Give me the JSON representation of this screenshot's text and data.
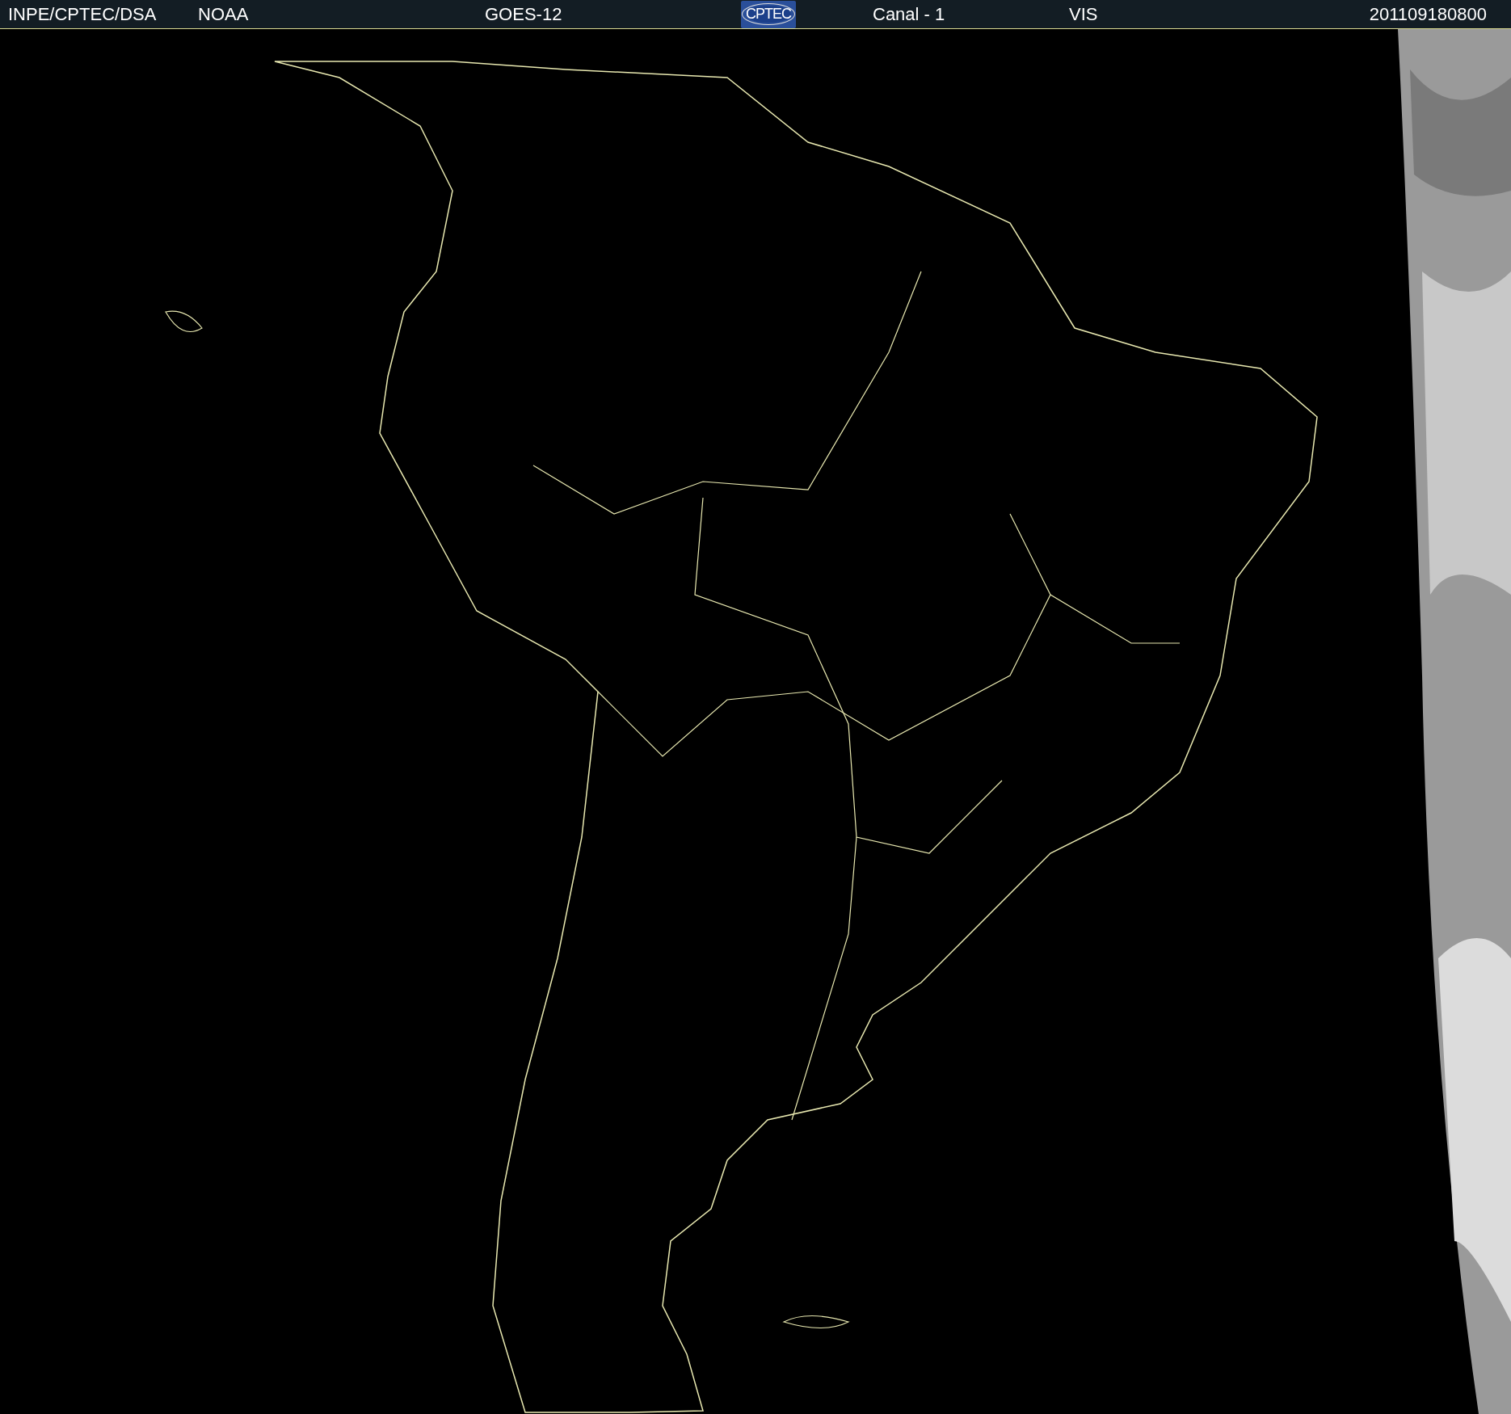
{
  "header": {
    "items": [
      {
        "kind": "text",
        "text": "INPE/CPTEC/DSA"
      },
      {
        "kind": "text",
        "text": "NOAA"
      },
      {
        "kind": "text",
        "text": "GOES-12"
      },
      {
        "kind": "logo",
        "text": "CPTEC"
      },
      {
        "kind": "text",
        "text": "Canal - 1"
      },
      {
        "kind": "text",
        "text": "VIS"
      },
      {
        "kind": "text",
        "text": "201109180800"
      }
    ]
  }
}
